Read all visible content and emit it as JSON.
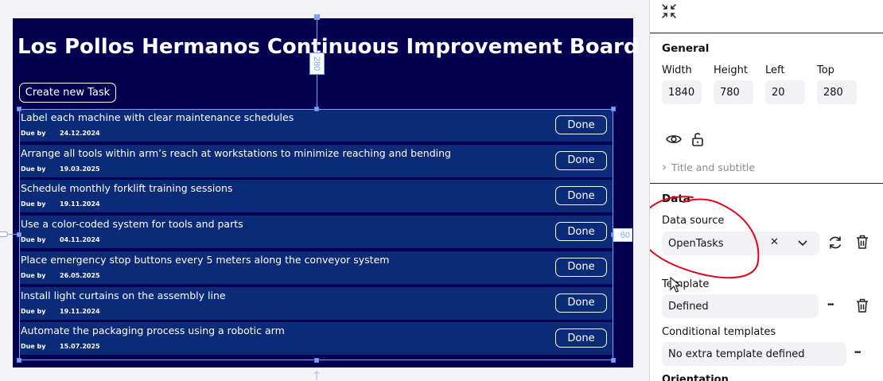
{
  "board": {
    "title": "Los Pollos Hermanos Continuous Improvement Board",
    "create_button": "Create new Task",
    "due_label": "Due by",
    "done_label": "Done",
    "background_color": "#04004f",
    "row_color": "#0b2a78",
    "tasks": [
      {
        "title": "Label each machine with clear maintenance schedules",
        "due": "24.12.2024"
      },
      {
        "title": "Arrange all tools within arm’s reach at workstations to minimize reaching and bending",
        "due": "19.03.2025"
      },
      {
        "title": "Schedule monthly forklift training sessions",
        "due": "19.11.2024"
      },
      {
        "title": "Use a color-coded system for tools and parts",
        "due": "04.11.2024"
      },
      {
        "title": "Place emergency stop buttons every 5 meters along the conveyor system",
        "due": "26.05.2025"
      },
      {
        "title": "Install light curtains on the assembly line",
        "due": "19.11.2024"
      },
      {
        "title": "Automate the packaging process using a robotic arm",
        "due": "15.07.2025"
      }
    ]
  },
  "canvas_guides": {
    "top_distance": "280",
    "right_distance": "60"
  },
  "panel": {
    "general_heading": "General",
    "width_label": "Width",
    "width_value": "1840",
    "height_label": "Height",
    "height_value": "780",
    "left_label": "Left",
    "left_value": "20",
    "top_label": "Top",
    "top_value": "280",
    "title_subtitle": "Title and subtitle",
    "data_heading": "Data",
    "data_source_label": "Data source",
    "data_source_value": "OpenTasks",
    "template_label": "Template",
    "template_value": "Defined",
    "conditional_label": "Conditional templates",
    "conditional_value": "No extra template defined",
    "orientation_label": "Orientation",
    "clear_glyph": "✕",
    "more_glyph": "•••",
    "chevron_glyph": "›",
    "annotation_color": "#e0001b",
    "selection_color": "#7fa3ff"
  }
}
